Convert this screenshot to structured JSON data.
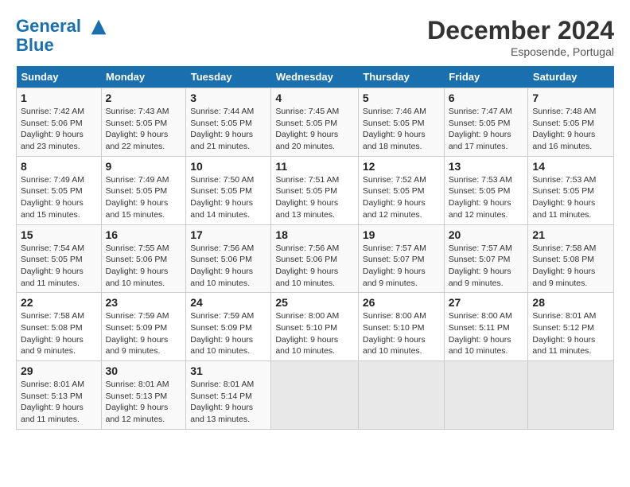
{
  "header": {
    "logo_line1": "General",
    "logo_line2": "Blue",
    "month": "December 2024",
    "location": "Esposende, Portugal"
  },
  "days_of_week": [
    "Sunday",
    "Monday",
    "Tuesday",
    "Wednesday",
    "Thursday",
    "Friday",
    "Saturday"
  ],
  "weeks": [
    [
      {
        "day": "1",
        "sunrise": "7:42 AM",
        "sunset": "5:06 PM",
        "daylight_hours": "9",
        "daylight_minutes": "23"
      },
      {
        "day": "2",
        "sunrise": "7:43 AM",
        "sunset": "5:05 PM",
        "daylight_hours": "9",
        "daylight_minutes": "22"
      },
      {
        "day": "3",
        "sunrise": "7:44 AM",
        "sunset": "5:05 PM",
        "daylight_hours": "9",
        "daylight_minutes": "21"
      },
      {
        "day": "4",
        "sunrise": "7:45 AM",
        "sunset": "5:05 PM",
        "daylight_hours": "9",
        "daylight_minutes": "20"
      },
      {
        "day": "5",
        "sunrise": "7:46 AM",
        "sunset": "5:05 PM",
        "daylight_hours": "9",
        "daylight_minutes": "18"
      },
      {
        "day": "6",
        "sunrise": "7:47 AM",
        "sunset": "5:05 PM",
        "daylight_hours": "9",
        "daylight_minutes": "17"
      },
      {
        "day": "7",
        "sunrise": "7:48 AM",
        "sunset": "5:05 PM",
        "daylight_hours": "9",
        "daylight_minutes": "16"
      }
    ],
    [
      {
        "day": "8",
        "sunrise": "7:49 AM",
        "sunset": "5:05 PM",
        "daylight_hours": "9",
        "daylight_minutes": "15"
      },
      {
        "day": "9",
        "sunrise": "7:49 AM",
        "sunset": "5:05 PM",
        "daylight_hours": "9",
        "daylight_minutes": "15"
      },
      {
        "day": "10",
        "sunrise": "7:50 AM",
        "sunset": "5:05 PM",
        "daylight_hours": "9",
        "daylight_minutes": "14"
      },
      {
        "day": "11",
        "sunrise": "7:51 AM",
        "sunset": "5:05 PM",
        "daylight_hours": "9",
        "daylight_minutes": "13"
      },
      {
        "day": "12",
        "sunrise": "7:52 AM",
        "sunset": "5:05 PM",
        "daylight_hours": "9",
        "daylight_minutes": "12"
      },
      {
        "day": "13",
        "sunrise": "7:53 AM",
        "sunset": "5:05 PM",
        "daylight_hours": "9",
        "daylight_minutes": "12"
      },
      {
        "day": "14",
        "sunrise": "7:53 AM",
        "sunset": "5:05 PM",
        "daylight_hours": "9",
        "daylight_minutes": "11"
      }
    ],
    [
      {
        "day": "15",
        "sunrise": "7:54 AM",
        "sunset": "5:05 PM",
        "daylight_hours": "9",
        "daylight_minutes": "11"
      },
      {
        "day": "16",
        "sunrise": "7:55 AM",
        "sunset": "5:06 PM",
        "daylight_hours": "9",
        "daylight_minutes": "10"
      },
      {
        "day": "17",
        "sunrise": "7:56 AM",
        "sunset": "5:06 PM",
        "daylight_hours": "9",
        "daylight_minutes": "10"
      },
      {
        "day": "18",
        "sunrise": "7:56 AM",
        "sunset": "5:06 PM",
        "daylight_hours": "9",
        "daylight_minutes": "10"
      },
      {
        "day": "19",
        "sunrise": "7:57 AM",
        "sunset": "5:07 PM",
        "daylight_hours": "9",
        "daylight_minutes": "9"
      },
      {
        "day": "20",
        "sunrise": "7:57 AM",
        "sunset": "5:07 PM",
        "daylight_hours": "9",
        "daylight_minutes": "9"
      },
      {
        "day": "21",
        "sunrise": "7:58 AM",
        "sunset": "5:08 PM",
        "daylight_hours": "9",
        "daylight_minutes": "9"
      }
    ],
    [
      {
        "day": "22",
        "sunrise": "7:58 AM",
        "sunset": "5:08 PM",
        "daylight_hours": "9",
        "daylight_minutes": "9"
      },
      {
        "day": "23",
        "sunrise": "7:59 AM",
        "sunset": "5:09 PM",
        "daylight_hours": "9",
        "daylight_minutes": "9"
      },
      {
        "day": "24",
        "sunrise": "7:59 AM",
        "sunset": "5:09 PM",
        "daylight_hours": "9",
        "daylight_minutes": "10"
      },
      {
        "day": "25",
        "sunrise": "8:00 AM",
        "sunset": "5:10 PM",
        "daylight_hours": "9",
        "daylight_minutes": "10"
      },
      {
        "day": "26",
        "sunrise": "8:00 AM",
        "sunset": "5:10 PM",
        "daylight_hours": "9",
        "daylight_minutes": "10"
      },
      {
        "day": "27",
        "sunrise": "8:00 AM",
        "sunset": "5:11 PM",
        "daylight_hours": "9",
        "daylight_minutes": "10"
      },
      {
        "day": "28",
        "sunrise": "8:01 AM",
        "sunset": "5:12 PM",
        "daylight_hours": "9",
        "daylight_minutes": "11"
      }
    ],
    [
      {
        "day": "29",
        "sunrise": "8:01 AM",
        "sunset": "5:13 PM",
        "daylight_hours": "9",
        "daylight_minutes": "11"
      },
      {
        "day": "30",
        "sunrise": "8:01 AM",
        "sunset": "5:13 PM",
        "daylight_hours": "9",
        "daylight_minutes": "12"
      },
      {
        "day": "31",
        "sunrise": "8:01 AM",
        "sunset": "5:14 PM",
        "daylight_hours": "9",
        "daylight_minutes": "13"
      },
      null,
      null,
      null,
      null
    ]
  ]
}
